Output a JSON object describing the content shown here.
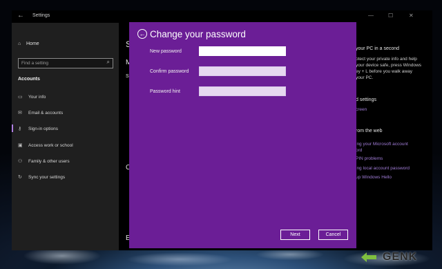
{
  "window": {
    "title": "Settings",
    "controls": {
      "minimize": "—",
      "maximize": "☐",
      "close": "✕"
    }
  },
  "sidebar": {
    "home": "Home",
    "search_placeholder": "Find a setting",
    "section": "Accounts",
    "items": [
      {
        "label": "Your info",
        "icon": "person-card-icon"
      },
      {
        "label": "Email & accounts",
        "icon": "mail-icon"
      },
      {
        "label": "Sign-in options",
        "icon": "key-icon",
        "active": true
      },
      {
        "label": "Access work or school",
        "icon": "briefcase-icon"
      },
      {
        "label": "Family & other users",
        "icon": "people-icon"
      },
      {
        "label": "Sync your settings",
        "icon": "sync-icon"
      }
    ]
  },
  "main": {
    "frag1": "S",
    "frag2": "M",
    "frag3": "S",
    "frag4": "C",
    "frag5": "E"
  },
  "right_panel": {
    "heading1": "your PC in a second",
    "para": [
      "otect your private info and help",
      "your device safe, press Windows",
      "ey + L before you walk away",
      "your PC."
    ],
    "heading2": "d settings",
    "link0": "creen",
    "heading3": "rom the web",
    "links": [
      "ing your Microsoft account",
      "ord",
      "PIN problems",
      "ing local account password",
      "up Windows Hello"
    ]
  },
  "dialog": {
    "title": "Change your password",
    "fields": {
      "new_password": {
        "label": "New password",
        "value": ""
      },
      "confirm_password": {
        "label": "Confirm password",
        "value": ""
      },
      "password_hint": {
        "label": "Password hint",
        "value": ""
      }
    },
    "next_label": "Next",
    "cancel_label": "Cancel",
    "accent": "#6b1e96"
  },
  "watermark": {
    "brand": "GENK"
  }
}
